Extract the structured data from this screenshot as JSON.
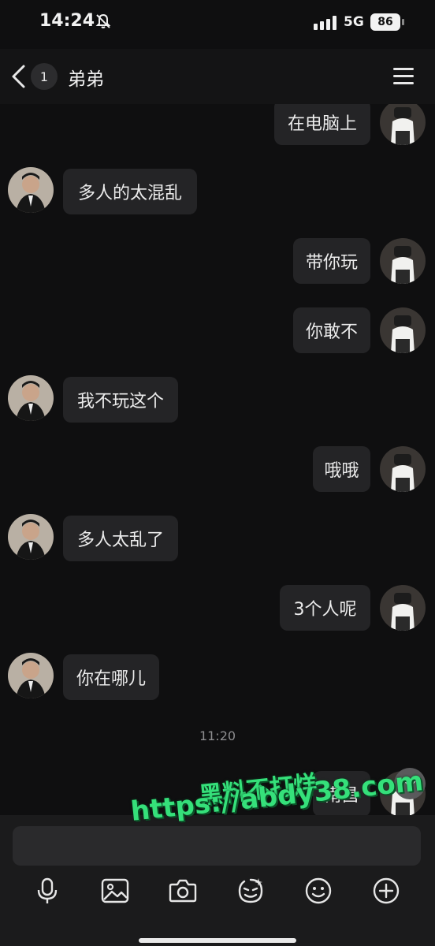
{
  "status": {
    "time": "14:24",
    "network": "5G",
    "battery": "86"
  },
  "header": {
    "unread_count": "1",
    "title": "弟弟"
  },
  "messages": [
    {
      "side": "right",
      "text": "在电脑上"
    },
    {
      "side": "left",
      "text": "多人的太混乱"
    },
    {
      "side": "right",
      "text": "带你玩"
    },
    {
      "side": "right",
      "text": "你敢不"
    },
    {
      "side": "left",
      "text": "我不玩这个"
    },
    {
      "side": "right",
      "text": "哦哦"
    },
    {
      "side": "left",
      "text": "多人太乱了"
    },
    {
      "side": "right",
      "text": "3个人呢"
    },
    {
      "side": "left",
      "text": "你在哪儿"
    },
    {
      "side": "right",
      "text": "南昌"
    }
  ],
  "timestamp": "11:20",
  "watermark": {
    "line1": "黑料不打烊",
    "line2": "https://abdy38.com"
  },
  "toolbar": [
    "microphone-icon",
    "image-icon",
    "camera-icon",
    "sticker-icon",
    "emoji-icon",
    "plus-icon"
  ],
  "colors": {
    "background": "#0f0f10",
    "bubble": "#242426",
    "watermark": "#35e07a"
  }
}
